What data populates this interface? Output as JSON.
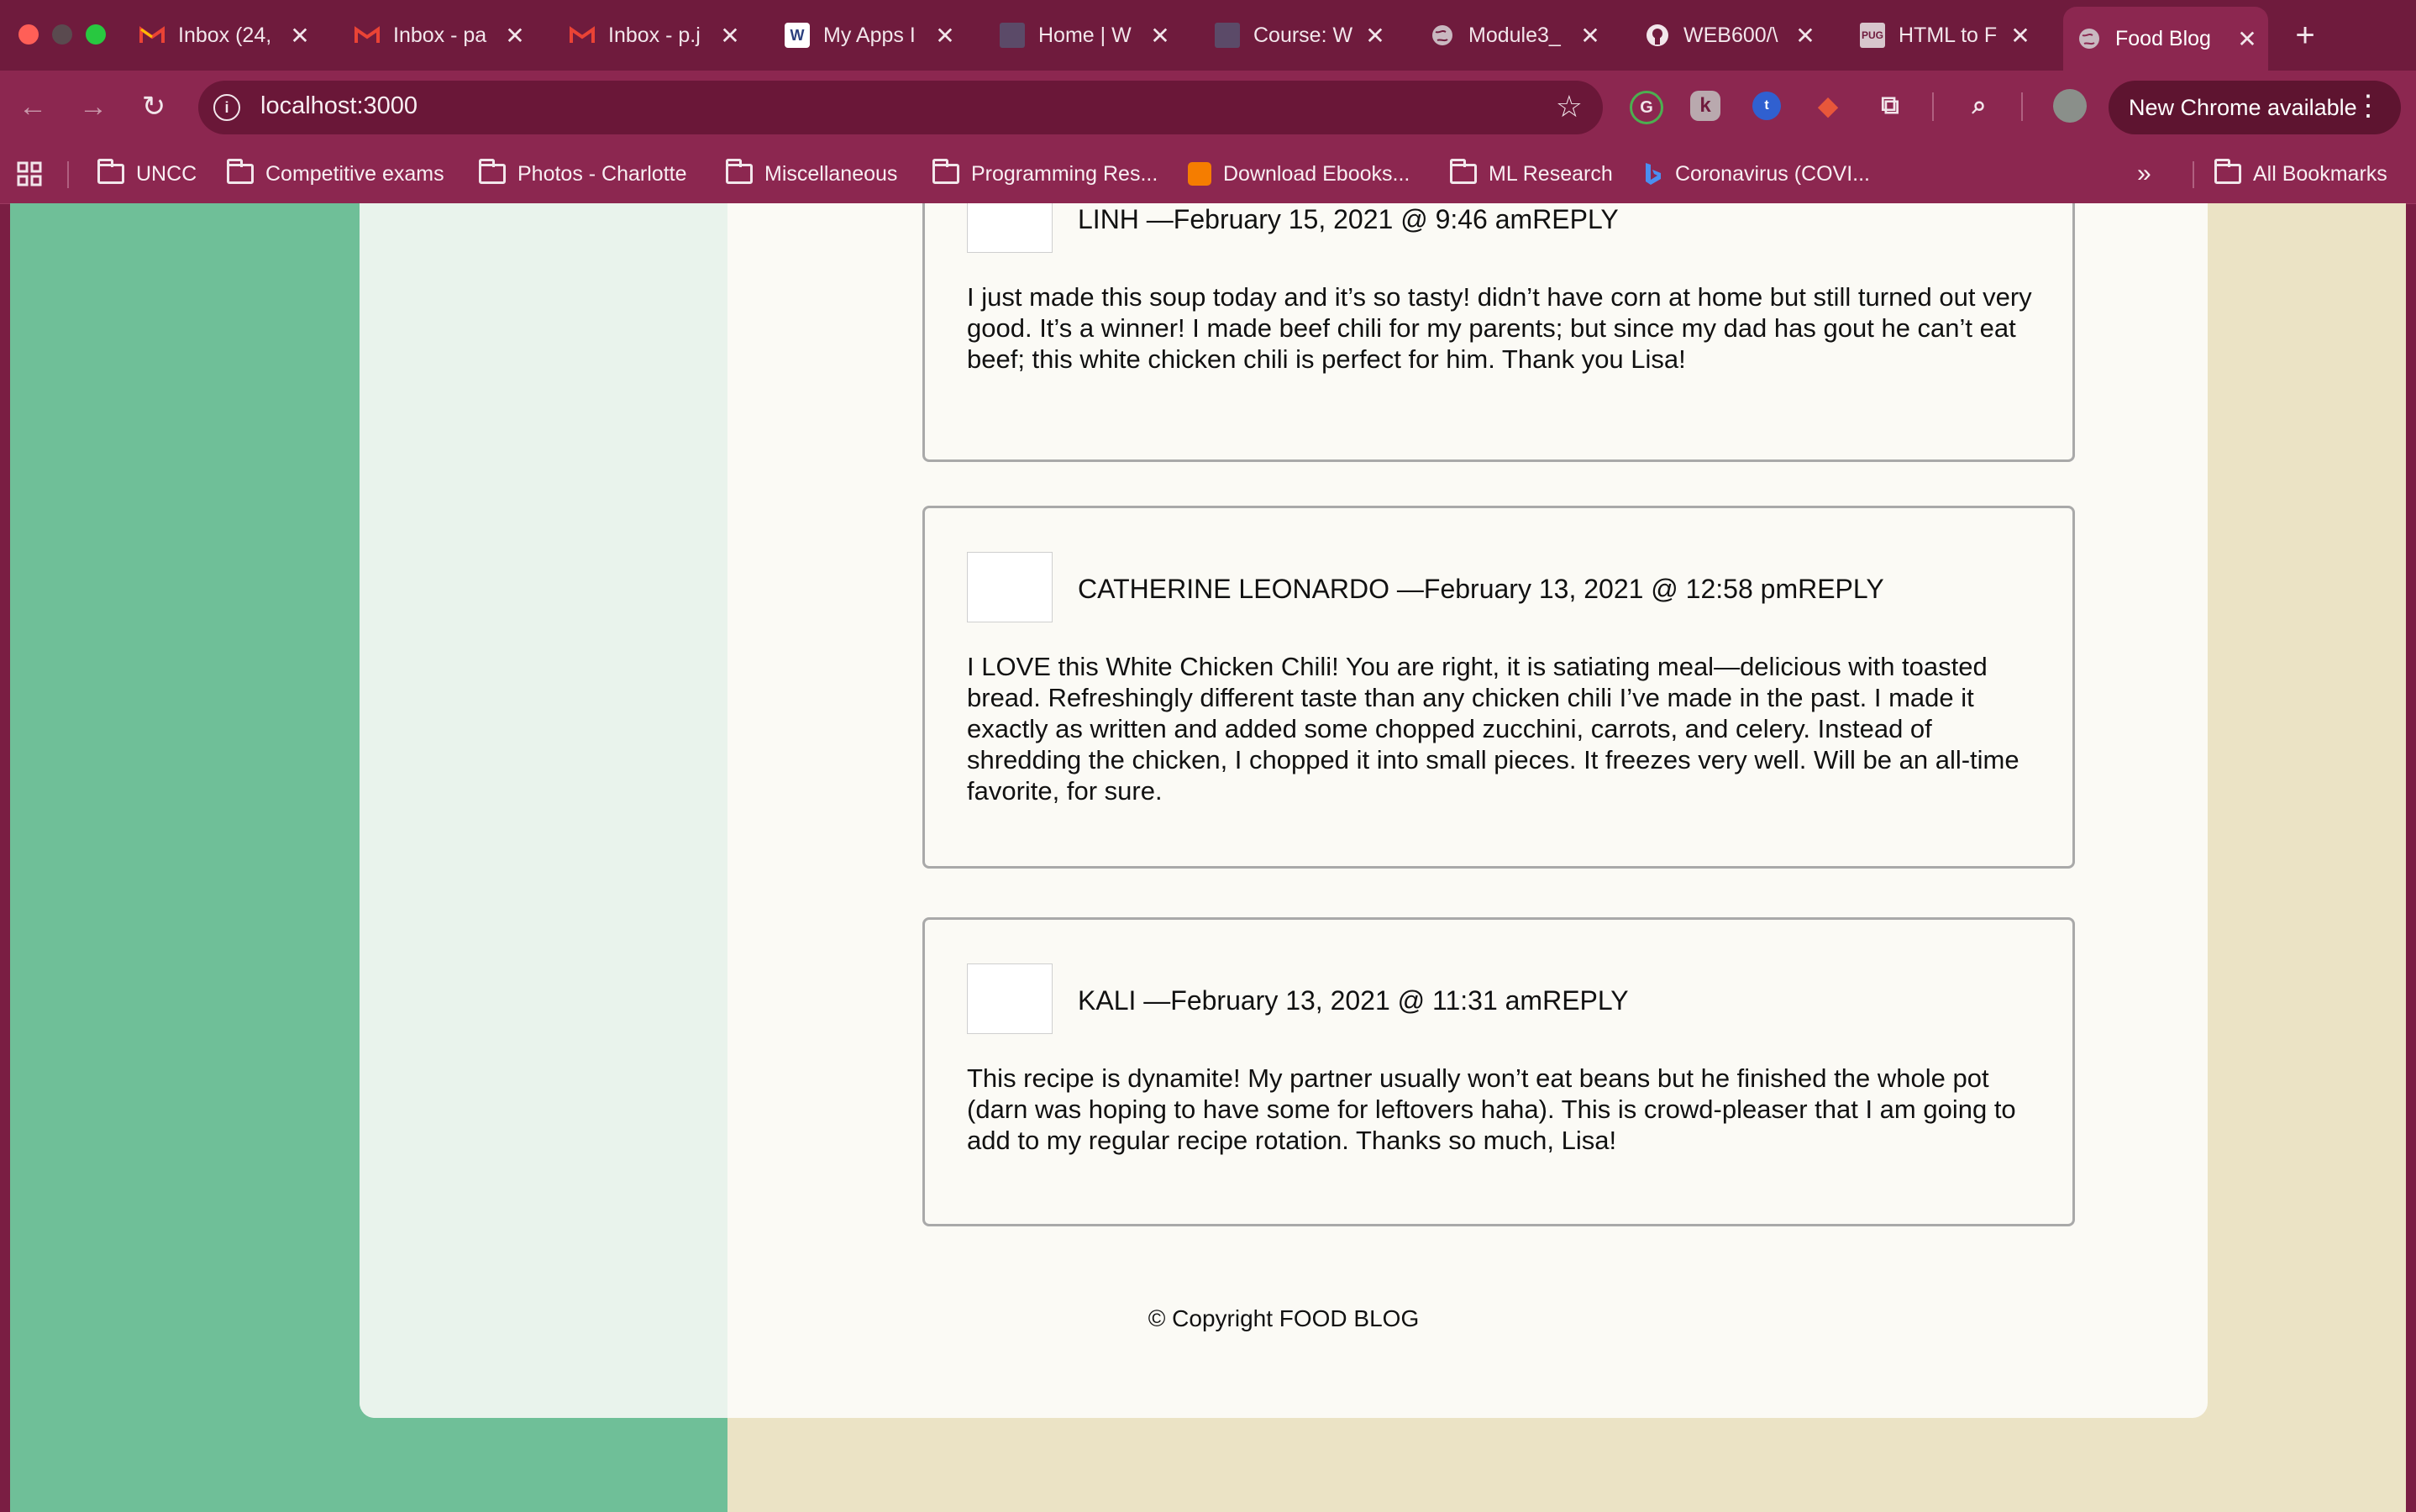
{
  "tabs": [
    {
      "title": "Inbox (24,",
      "favicon": "gmail-icon"
    },
    {
      "title": "Inbox - pa",
      "favicon": "gmail-icon"
    },
    {
      "title": "Inbox - p.j",
      "favicon": "gmail-icon"
    },
    {
      "title": "My Apps I",
      "favicon": "w-icon"
    },
    {
      "title": "Home | W",
      "favicon": "course-icon"
    },
    {
      "title": "Course: W",
      "favicon": "course-icon"
    },
    {
      "title": "Module3_",
      "favicon": "globe-icon"
    },
    {
      "title": "WEB600/\\",
      "favicon": "github-icon"
    },
    {
      "title": "HTML to F",
      "favicon": "pug-icon"
    },
    {
      "title": "Food Blog",
      "favicon": "globe-icon"
    }
  ],
  "address_bar": {
    "url": "localhost:3000"
  },
  "toolbar": {
    "new_chrome_label": "New Chrome available"
  },
  "bookmarks": [
    {
      "label": "UNCC",
      "icon": "folder-icon"
    },
    {
      "label": "Competitive exams",
      "icon": "folder-icon"
    },
    {
      "label": "Photos - Charlotte",
      "icon": "folder-icon"
    },
    {
      "label": "Miscellaneous",
      "icon": "folder-icon"
    },
    {
      "label": "Programming Res...",
      "icon": "folder-icon"
    },
    {
      "label": "Download Ebooks...",
      "icon": "blogger-icon"
    },
    {
      "label": "ML Research",
      "icon": "folder-icon"
    },
    {
      "label": "Coronavirus (COVI...",
      "icon": "bing-icon"
    },
    {
      "label": "All Bookmarks",
      "icon": "folder-icon"
    }
  ],
  "comments": [
    {
      "author": "LINH",
      "date": "—February 15, 2021 @ 9:46 am",
      "reply": "REPLY",
      "text": "I just made this soup today and it’s so tasty! didn’t have corn at home but still turned out very good. It’s a winner! I made beef chili for my parents; but since my dad has gout he can’t eat beef; this white chicken chili is perfect for him. Thank you Lisa!"
    },
    {
      "author": "CATHERINE LEONARDO",
      "date": "—February 13, 2021 @ 12:58 pm",
      "reply": "REPLY",
      "text": "I LOVE this White Chicken Chili! You are right, it is satiating meal—delicious with toasted bread. Refreshingly different taste than any chicken chili I’ve made in the past. I made it exactly as written and added some chopped zucchini, carrots, and celery. Instead of shredding the chicken, I chopped it into small pieces. It freezes very well. Will be an all-time favorite, for sure."
    },
    {
      "author": "KALI",
      "date": "—February 13, 2021 @ 11:31 am",
      "reply": "REPLY",
      "text": "This recipe is dynamite! My partner usually won’t eat beans but he finished the whole pot (darn was hoping to have some for leftovers haha). This is crowd-pleaser that I am going to add to my regular recipe rotation. Thanks so much, Lisa!"
    }
  ],
  "footer": {
    "copyright": "© Copyright FOOD BLOG"
  },
  "colors": {
    "chrome_frame": "#6f1b3d",
    "toolbar": "#8c2750",
    "green_column": "#6fbf98",
    "beige_bg": "#ebe3c5",
    "card_bg": "#fbfaf5"
  }
}
